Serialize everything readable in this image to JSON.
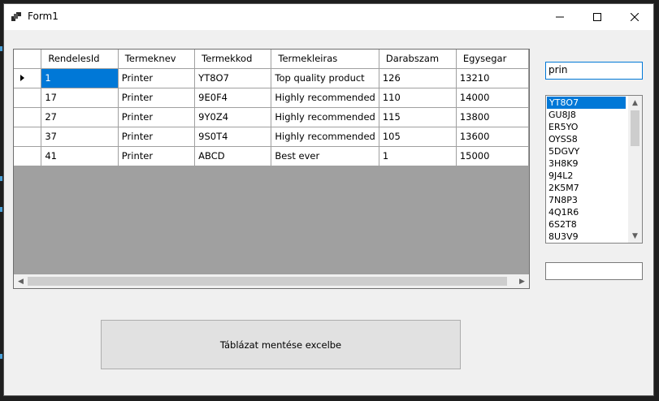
{
  "window": {
    "title": "Form1"
  },
  "grid": {
    "columns": [
      "RendelesId",
      "Termeknev",
      "Termekkod",
      "Termekleiras",
      "Darabszam",
      "Egysegar"
    ],
    "rows": [
      [
        "1",
        "Printer",
        "YT8O7",
        "Top quality product",
        "126",
        "13210"
      ],
      [
        "17",
        "Printer",
        "9E0F4",
        "Highly recommended",
        "110",
        "14000"
      ],
      [
        "27",
        "Printer",
        "9Y0Z4",
        "Highly recommended",
        "115",
        "13800"
      ],
      [
        "37",
        "Printer",
        "9S0T4",
        "Highly recommended",
        "105",
        "13600"
      ],
      [
        "41",
        "Printer",
        "ABCD",
        "Best ever",
        "1",
        "15000"
      ]
    ]
  },
  "search": {
    "value": "prin"
  },
  "listbox": {
    "items": [
      "YT8O7",
      "GU8J8",
      "ER5YO",
      "OYSS8",
      "5DGVY",
      "3H8K9",
      "9J4L2",
      "2K5M7",
      "7N8P3",
      "4Q1R6",
      "6S2T8",
      "8U3V9"
    ]
  },
  "textbox2": {
    "value": ""
  },
  "export_button": {
    "label": "Táblázat mentése excelbe"
  }
}
